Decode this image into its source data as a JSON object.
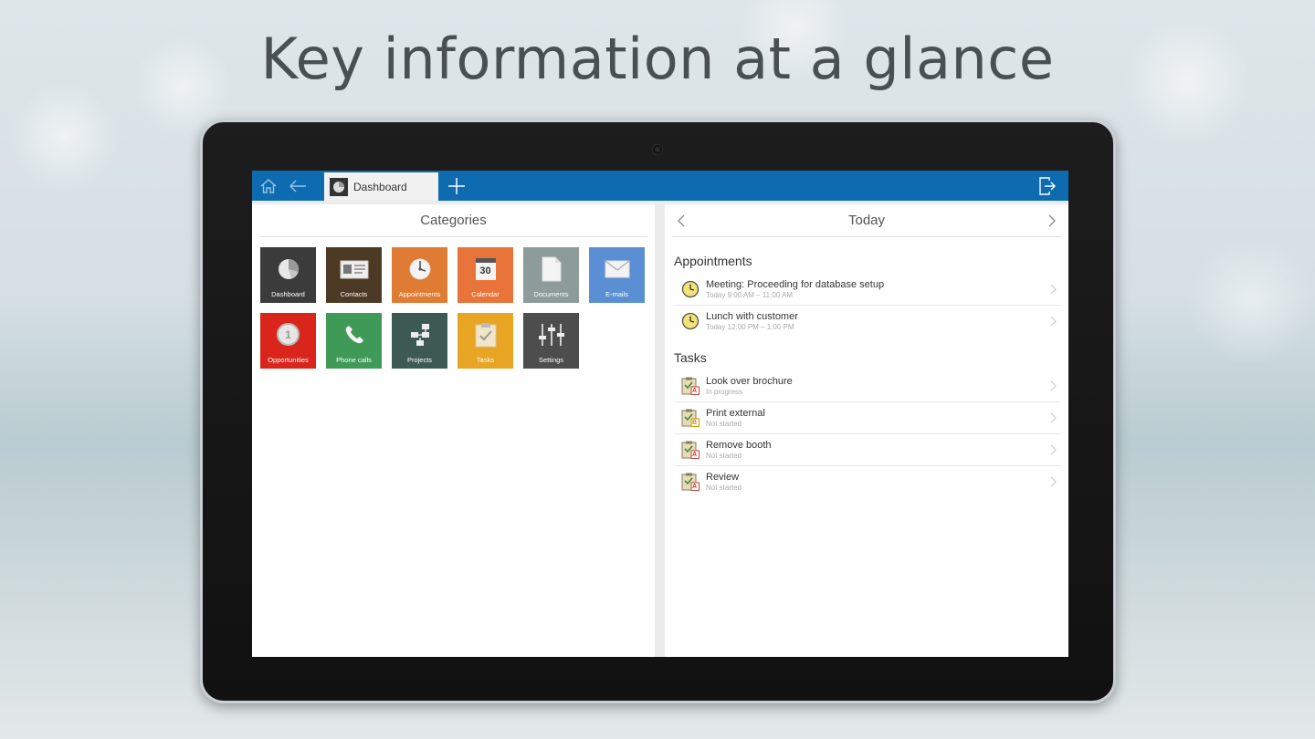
{
  "headline": "Key information at a glance",
  "topbar": {
    "tab_label": "Dashboard"
  },
  "categories": {
    "title": "Categories",
    "tiles": [
      {
        "label": "Dashboard",
        "color": "#3b3b3b",
        "icon": "pie-chart-icon"
      },
      {
        "label": "Contacts",
        "color": "#4d3a24",
        "icon": "contact-card-icon"
      },
      {
        "label": "Appointments",
        "color": "#e07b33",
        "icon": "clock-icon"
      },
      {
        "label": "Calendar",
        "color": "#e8743a",
        "icon": "calendar-icon"
      },
      {
        "label": "Documents",
        "color": "#8d9b99",
        "icon": "document-icon"
      },
      {
        "label": "E-mails",
        "color": "#5b8fd4",
        "icon": "envelope-icon"
      },
      {
        "label": "Opportunities",
        "color": "#d9251c",
        "icon": "coin-icon"
      },
      {
        "label": "Phone calls",
        "color": "#3f9a57",
        "icon": "phone-icon"
      },
      {
        "label": "Projects",
        "color": "#3c5a52",
        "icon": "org-chart-icon"
      },
      {
        "label": "Tasks",
        "color": "#e8a524",
        "icon": "clipboard-icon"
      },
      {
        "label": "Settings",
        "color": "#4d4d4d",
        "icon": "sliders-icon"
      }
    ],
    "calendar_day": "30",
    "coin_value": "1"
  },
  "today": {
    "title": "Today",
    "appointments_title": "Appointments",
    "appointments": [
      {
        "title": "Meeting: Proceeding for database setup",
        "sub": "Today 9:00 AM – 11:00 AM"
      },
      {
        "title": "Lunch with customer",
        "sub": "Today 12:00 PM – 1:00 PM"
      }
    ],
    "tasks_title": "Tasks",
    "tasks": [
      {
        "title": "Look over brochure",
        "sub": "In progress",
        "priority": "A"
      },
      {
        "title": "Print external",
        "sub": "Not started",
        "priority": "B"
      },
      {
        "title": "Remove booth",
        "sub": "Not started",
        "priority": "A"
      },
      {
        "title": "Review",
        "sub": "Not started",
        "priority": "A"
      }
    ]
  }
}
